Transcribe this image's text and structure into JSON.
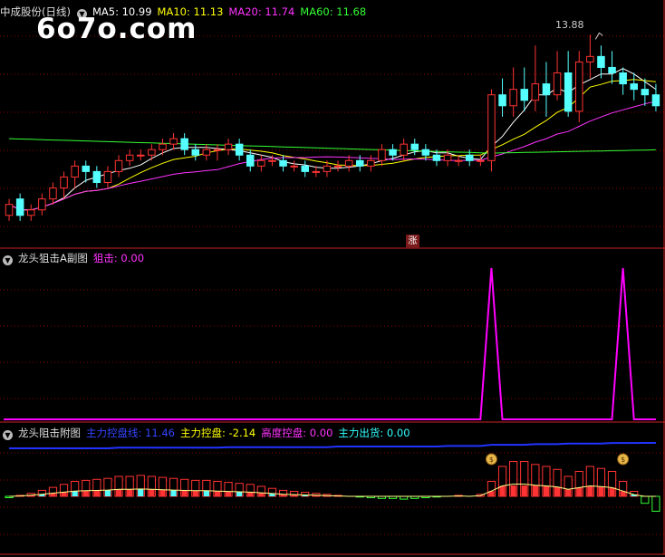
{
  "panel1": {
    "title": "中成股份(日线)",
    "ma": [
      {
        "label": "MA5: 10.99",
        "color": "#ffffff"
      },
      {
        "label": "MA10: 11.13",
        "color": "#ffff00"
      },
      {
        "label": "MA20: 11.74",
        "color": "#ff00ff"
      },
      {
        "label": "MA60: 11.68",
        "color": "#00ff00"
      }
    ],
    "high_label": "13.88",
    "tag": "涨"
  },
  "watermark": "6o7o.com",
  "panel2": {
    "title": "龙头狙击A副图",
    "indicator": "狙击: 0.00",
    "color": "#ff33ff"
  },
  "panel3": {
    "title": "龙头阻击附图",
    "items": [
      {
        "label": "主力控盘线: 11.46",
        "color": "#2233ff"
      },
      {
        "label": "主力控盘: -2.14",
        "color": "#ffff00"
      },
      {
        "label": "高度控盘: 0.00",
        "color": "#ff00ff"
      },
      {
        "label": "主力出货: 0.00",
        "color": "#00ffff"
      }
    ]
  },
  "colors": {
    "up": "#ff3333",
    "down": "#55ffff",
    "grid": "#8b0000",
    "border": "#cc2222"
  },
  "chart_data": [
    {
      "type": "candlestick",
      "series": [
        {
          "name": "K",
          "values": [
            [
              10.6,
              10.8,
              10.5,
              10.9
            ],
            [
              10.9,
              10.6,
              10.5,
              11.0
            ],
            [
              10.6,
              10.7,
              10.5,
              10.8
            ],
            [
              10.7,
              10.9,
              10.6,
              11.0
            ],
            [
              10.9,
              11.1,
              10.8,
              11.2
            ],
            [
              11.1,
              11.3,
              10.9,
              11.4
            ],
            [
              11.3,
              11.5,
              11.1,
              11.6
            ],
            [
              11.5,
              11.4,
              11.2,
              11.6
            ],
            [
              11.4,
              11.2,
              11.1,
              11.5
            ],
            [
              11.2,
              11.4,
              11.1,
              11.5
            ],
            [
              11.4,
              11.6,
              11.3,
              11.7
            ],
            [
              11.6,
              11.7,
              11.5,
              11.8
            ],
            [
              11.7,
              11.7,
              11.6,
              11.8
            ],
            [
              11.7,
              11.8,
              11.6,
              11.9
            ],
            [
              11.8,
              11.9,
              11.7,
              12.0
            ],
            [
              11.9,
              12.0,
              11.8,
              12.1
            ],
            [
              12.0,
              11.8,
              11.7,
              12.1
            ],
            [
              11.8,
              11.7,
              11.6,
              11.9
            ],
            [
              11.7,
              11.8,
              11.6,
              11.9
            ],
            [
              11.8,
              11.8,
              11.6,
              11.9
            ],
            [
              11.8,
              11.9,
              11.7,
              12.0
            ],
            [
              11.9,
              11.7,
              11.6,
              12.0
            ],
            [
              11.7,
              11.5,
              11.4,
              11.8
            ],
            [
              11.5,
              11.6,
              11.4,
              11.7
            ],
            [
              11.6,
              11.6,
              11.5,
              11.7
            ],
            [
              11.6,
              11.5,
              11.4,
              11.7
            ],
            [
              11.5,
              11.5,
              11.4,
              11.6
            ],
            [
              11.5,
              11.4,
              11.3,
              11.6
            ],
            [
              11.4,
              11.4,
              11.3,
              11.5
            ],
            [
              11.4,
              11.5,
              11.3,
              11.6
            ],
            [
              11.5,
              11.5,
              11.4,
              11.6
            ],
            [
              11.5,
              11.6,
              11.4,
              11.7
            ],
            [
              11.6,
              11.5,
              11.4,
              11.7
            ],
            [
              11.5,
              11.6,
              11.4,
              11.7
            ],
            [
              11.6,
              11.8,
              11.5,
              11.9
            ],
            [
              11.8,
              11.7,
              11.6,
              11.9
            ],
            [
              11.7,
              11.9,
              11.6,
              12.0
            ],
            [
              11.9,
              11.8,
              11.7,
              12.0
            ],
            [
              11.8,
              11.7,
              11.6,
              11.9
            ],
            [
              11.7,
              11.6,
              11.5,
              11.8
            ],
            [
              11.6,
              11.7,
              11.5,
              11.8
            ],
            [
              11.6,
              11.6,
              11.5,
              11.7
            ],
            [
              11.7,
              11.6,
              11.5,
              11.8
            ],
            [
              11.6,
              11.6,
              11.5,
              11.7
            ],
            [
              11.6,
              12.8,
              11.4,
              12.9
            ],
            [
              12.8,
              12.6,
              12.4,
              13.1
            ],
            [
              12.6,
              12.9,
              12.4,
              13.3
            ],
            [
              12.9,
              12.7,
              12.5,
              13.3
            ],
            [
              12.7,
              13.0,
              12.5,
              13.7
            ],
            [
              13.0,
              12.8,
              12.4,
              13.4
            ],
            [
              12.8,
              13.2,
              12.7,
              13.6
            ],
            [
              13.2,
              12.5,
              12.4,
              13.6
            ],
            [
              12.5,
              13.4,
              12.3,
              13.6
            ],
            [
              13.4,
              13.5,
              13.1,
              13.9
            ],
            [
              13.5,
              13.3,
              13.1,
              13.7
            ],
            [
              13.3,
              13.2,
              13.0,
              13.6
            ],
            [
              13.2,
              13.0,
              12.8,
              13.3
            ],
            [
              13.0,
              12.9,
              12.7,
              13.2
            ],
            [
              12.9,
              12.8,
              12.6,
              13.1
            ],
            [
              12.8,
              12.6,
              12.5,
              13.0
            ]
          ]
        }
      ],
      "ma_series": [
        "MA5",
        "MA10",
        "MA20",
        "MA60"
      ],
      "high_marker": 13.88
    },
    {
      "type": "line",
      "series": [
        {
          "name": "狙击",
          "values": [
            0,
            0,
            0,
            0,
            0,
            0,
            0,
            0,
            0,
            0,
            0,
            0,
            0,
            0,
            0,
            0,
            0,
            0,
            0,
            0,
            0,
            0,
            0,
            0,
            0,
            0,
            0,
            0,
            0,
            0,
            0,
            0,
            0,
            0,
            0,
            0,
            0,
            0,
            0,
            0,
            0,
            0,
            0,
            0,
            1,
            0,
            0,
            0,
            0,
            0,
            0,
            0,
            0,
            0,
            0,
            0,
            1,
            0,
            0,
            0
          ]
        }
      ]
    },
    {
      "type": "bar",
      "series": [
        {
          "name": "主力控盘线",
          "values": [
            11.0,
            11.0,
            11.0,
            11.0,
            11.0,
            11.0,
            11.0,
            11.0,
            11.0,
            11.0,
            11.05,
            11.05,
            11.05,
            11.05,
            11.05,
            11.05,
            11.05,
            11.05,
            11.05,
            11.05,
            11.1,
            11.1,
            11.1,
            11.1,
            11.1,
            11.1,
            11.1,
            11.1,
            11.1,
            11.1,
            11.15,
            11.15,
            11.15,
            11.15,
            11.15,
            11.15,
            11.15,
            11.15,
            11.15,
            11.15,
            11.2,
            11.2,
            11.2,
            11.2,
            11.3,
            11.3,
            11.3,
            11.3,
            11.35,
            11.35,
            11.35,
            11.4,
            11.4,
            11.4,
            11.4,
            11.45,
            11.45,
            11.45,
            11.46,
            11.46
          ]
        },
        {
          "name": "主力控盘",
          "values": [
            -0.2,
            0.1,
            0.3,
            0.6,
            0.9,
            1.2,
            1.5,
            1.6,
            1.7,
            1.8,
            2.0,
            2.0,
            2.1,
            2.0,
            1.9,
            1.8,
            1.7,
            1.6,
            1.6,
            1.5,
            1.4,
            1.3,
            1.2,
            1.0,
            0.8,
            0.6,
            0.5,
            0.4,
            0.3,
            0.2,
            0.1,
            0.0,
            -0.1,
            -0.2,
            -0.3,
            -0.3,
            -0.4,
            -0.3,
            -0.2,
            -0.1,
            0.0,
            0.1,
            0.0,
            0.2,
            1.5,
            3.0,
            3.5,
            3.5,
            3.2,
            3.0,
            2.7,
            2.0,
            2.5,
            3.0,
            2.8,
            2.5,
            1.5,
            0.5,
            -1.0,
            -2.14
          ]
        }
      ]
    }
  ]
}
